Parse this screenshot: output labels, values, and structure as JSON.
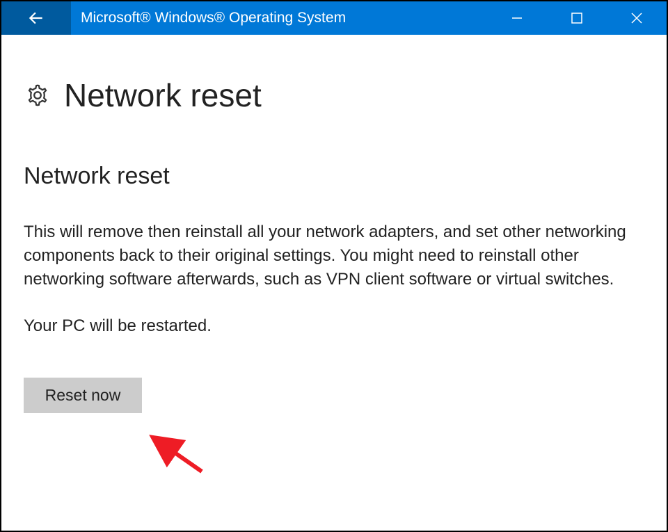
{
  "titlebar": {
    "title": "Microsoft® Windows® Operating System"
  },
  "page": {
    "title": "Network reset",
    "subtitle": "Network reset",
    "body": "This will remove then reinstall all your network adapters, and set other networking components back to their original settings. You might need to reinstall other networking software afterwards, such as VPN client software or virtual switches.",
    "restart_notice": "Your PC will be restarted.",
    "reset_button_label": "Reset now"
  },
  "colors": {
    "titlebar_bg": "#0078d7",
    "back_bg": "#005a9e",
    "button_bg": "#cccccc",
    "annotation": "#ee1c25"
  }
}
